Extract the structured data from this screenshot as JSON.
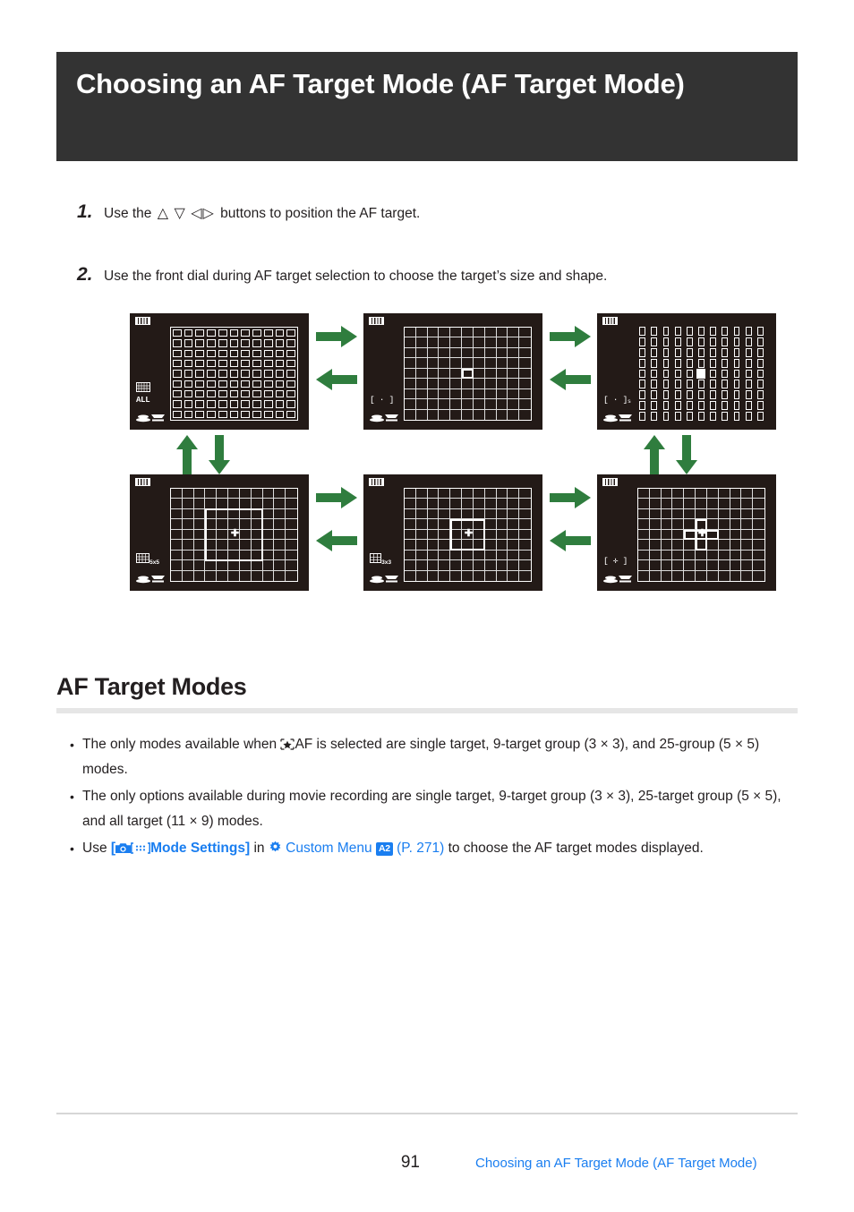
{
  "page": {
    "title": "Choosing an AF Target Mode (AF Target Mode)",
    "number": "91",
    "footer_link": "Choosing an AF Target Mode (AF Target Mode)"
  },
  "steps": [
    {
      "num": "1.",
      "text_before": "Use the",
      "glyphs": "△ ▽ ◁▷",
      "text_after": "buttons to position the AF target."
    },
    {
      "num": "2.",
      "text_before": "Use the front dial during AF target selection to choose the target’s size and shape.",
      "glyphs": "",
      "text_after": ""
    }
  ],
  "diagram": {
    "screens": [
      {
        "id": "all-target",
        "label": "ALL",
        "label_sub": "",
        "mode": "all (11 × 9)",
        "grid": "boxed-thick",
        "selection": "none"
      },
      {
        "id": "single-target",
        "label": "[ · ]",
        "label_sub": "",
        "mode": "single target",
        "grid": "lined",
        "selection": "single"
      },
      {
        "id": "small-target",
        "label": "[ · ]",
        "label_sub": "s",
        "mode": "small target",
        "grid": "boxed-narrow",
        "selection": "single-small"
      },
      {
        "id": "group-5x5",
        "label": "[   ]",
        "label_sub": "5x5",
        "mode": "25-target group (5 × 5)",
        "grid": "lined",
        "selection": "group5"
      },
      {
        "id": "group-3x3",
        "label": "[   ]",
        "label_sub": "3x3",
        "mode": "9-target group (3 × 3)",
        "grid": "lined",
        "selection": "group3"
      },
      {
        "id": "cross-target",
        "label": "[ ✛ ]",
        "label_sub": "",
        "mode": "cross target",
        "grid": "lined",
        "selection": "cross"
      }
    ],
    "arrow_color": "#2f7d3e"
  },
  "section": {
    "heading": "AF Target Modes"
  },
  "bullets": [
    {
      "id": "bullet-starraf-modes",
      "parts": [
        {
          "type": "text",
          "value": "The only modes available when "
        },
        {
          "type": "icon",
          "value": "star-af-icon"
        },
        {
          "type": "text",
          "value": "AF is selected are single target, 9-target group (3 × 3), and 25-group (5 × 5) modes."
        }
      ],
      "plain": "The only modes available when AF is selected are single target, 9-target group (3 × 3), and 25-group (5 × 5) modes."
    },
    {
      "id": "bullet-movie-modes",
      "parts": [
        {
          "type": "text",
          "value": "The only options available during movie recording are single target, 9-target group (3 × 3), 25-target group (5 × 5), and all target (11 × 9) modes."
        }
      ],
      "plain": "The only options available during movie recording are single target, 9-target group (3 × 3), 25-target group (5 × 5), and all target (11 × 9) modes."
    },
    {
      "id": "bullet-mode-settings",
      "use_label": "Use",
      "bracket_open": "[",
      "mode_settings_label": "Mode Settings]",
      "in_label": "in",
      "custom_menu_label": "Custom Menu",
      "badge": "A2",
      "page_ref": "(P. 271)",
      "tail": "to choose the AF target modes displayed."
    }
  ],
  "colors": {
    "title_bar_bg": "#333333",
    "link_blue": "#1a7ef0",
    "arrow_green": "#2f7d3e",
    "screen_bg": "#231a17",
    "rule_gray": "#e6e6e6"
  }
}
